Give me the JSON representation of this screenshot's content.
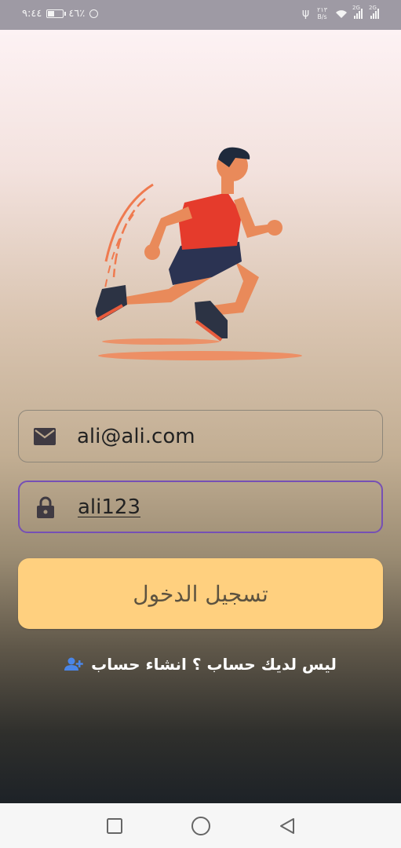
{
  "status_bar": {
    "time": "٩:٤٤",
    "battery_text": "٤٦٪",
    "battery_level": 0.46,
    "speed_value": "٢١٣",
    "speed_unit": "B/s",
    "signal1_tag": "2G",
    "signal2_tag": "2G"
  },
  "hero": {
    "image_icon": "runner-illustration-icon"
  },
  "login_form": {
    "email_value": "ali@ali.com",
    "email_icon": "mail-icon",
    "password_value": "ali123",
    "password_icon": "lock-icon",
    "login_label": "تسجيل الدخول"
  },
  "signup": {
    "text": "ليس لديك حساب ؟ انشاء حساب",
    "icon": "person-add-icon"
  },
  "nav": {
    "recents": "recents-square-icon",
    "home": "home-circle-icon",
    "back": "back-triangle-icon"
  },
  "colors": {
    "accent_border": "#7650b5",
    "button_bg": "#ffd07f",
    "button_text": "#5d5340",
    "icon_blue": "#4a86e8"
  }
}
